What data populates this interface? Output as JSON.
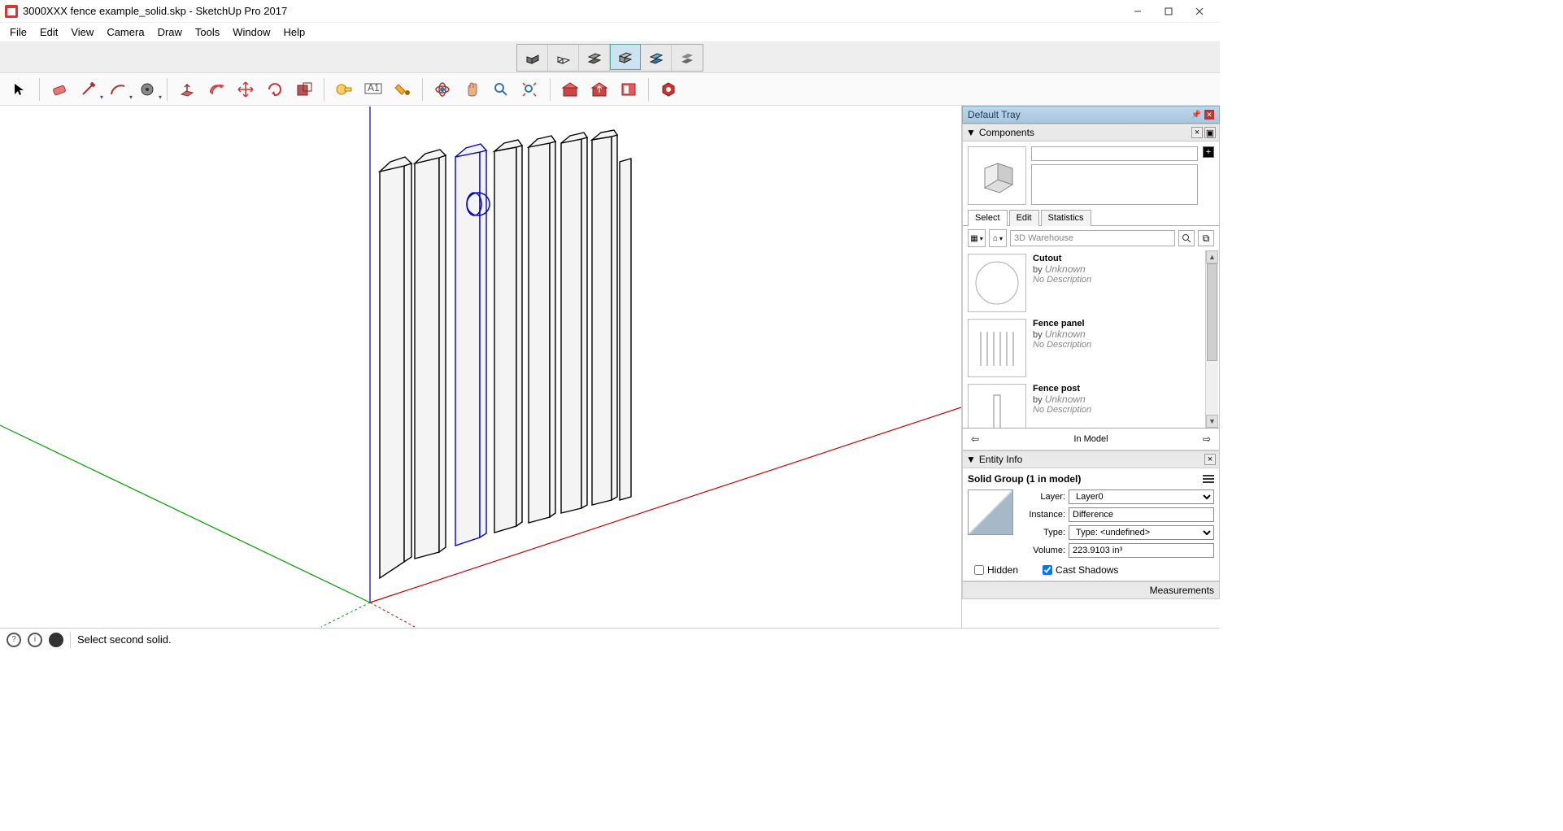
{
  "title": "3000XXX fence example_solid.skp - SketchUp Pro 2017",
  "menus": [
    "File",
    "Edit",
    "View",
    "Camera",
    "Draw",
    "Tools",
    "Window",
    "Help"
  ],
  "tray": {
    "title": "Default Tray",
    "components": {
      "heading": "Components",
      "tabs": [
        "Select",
        "Edit",
        "Statistics"
      ],
      "active_tab": 0,
      "search_placeholder": "3D Warehouse",
      "items": [
        {
          "title": "Cutout",
          "by": "Unknown",
          "desc": "No Description"
        },
        {
          "title": "Fence panel",
          "by": "Unknown",
          "desc": "No Description"
        },
        {
          "title": "Fence post",
          "by": "Unknown",
          "desc": "No Description"
        }
      ],
      "footer_label": "In Model"
    },
    "entity_info": {
      "heading": "Entity Info",
      "title": "Solid Group (1 in model)",
      "layer_label": "Layer:",
      "layer_value": "Layer0",
      "instance_label": "Instance:",
      "instance_value": "Difference",
      "type_label": "Type:",
      "type_value": "Type: <undefined>",
      "volume_label": "Volume:",
      "volume_value": "223.9103 in³",
      "hidden_label": "Hidden",
      "cast_label": "Cast Shadows"
    },
    "measurements_heading": "Measurements"
  },
  "status": {
    "text": "Select second solid."
  }
}
